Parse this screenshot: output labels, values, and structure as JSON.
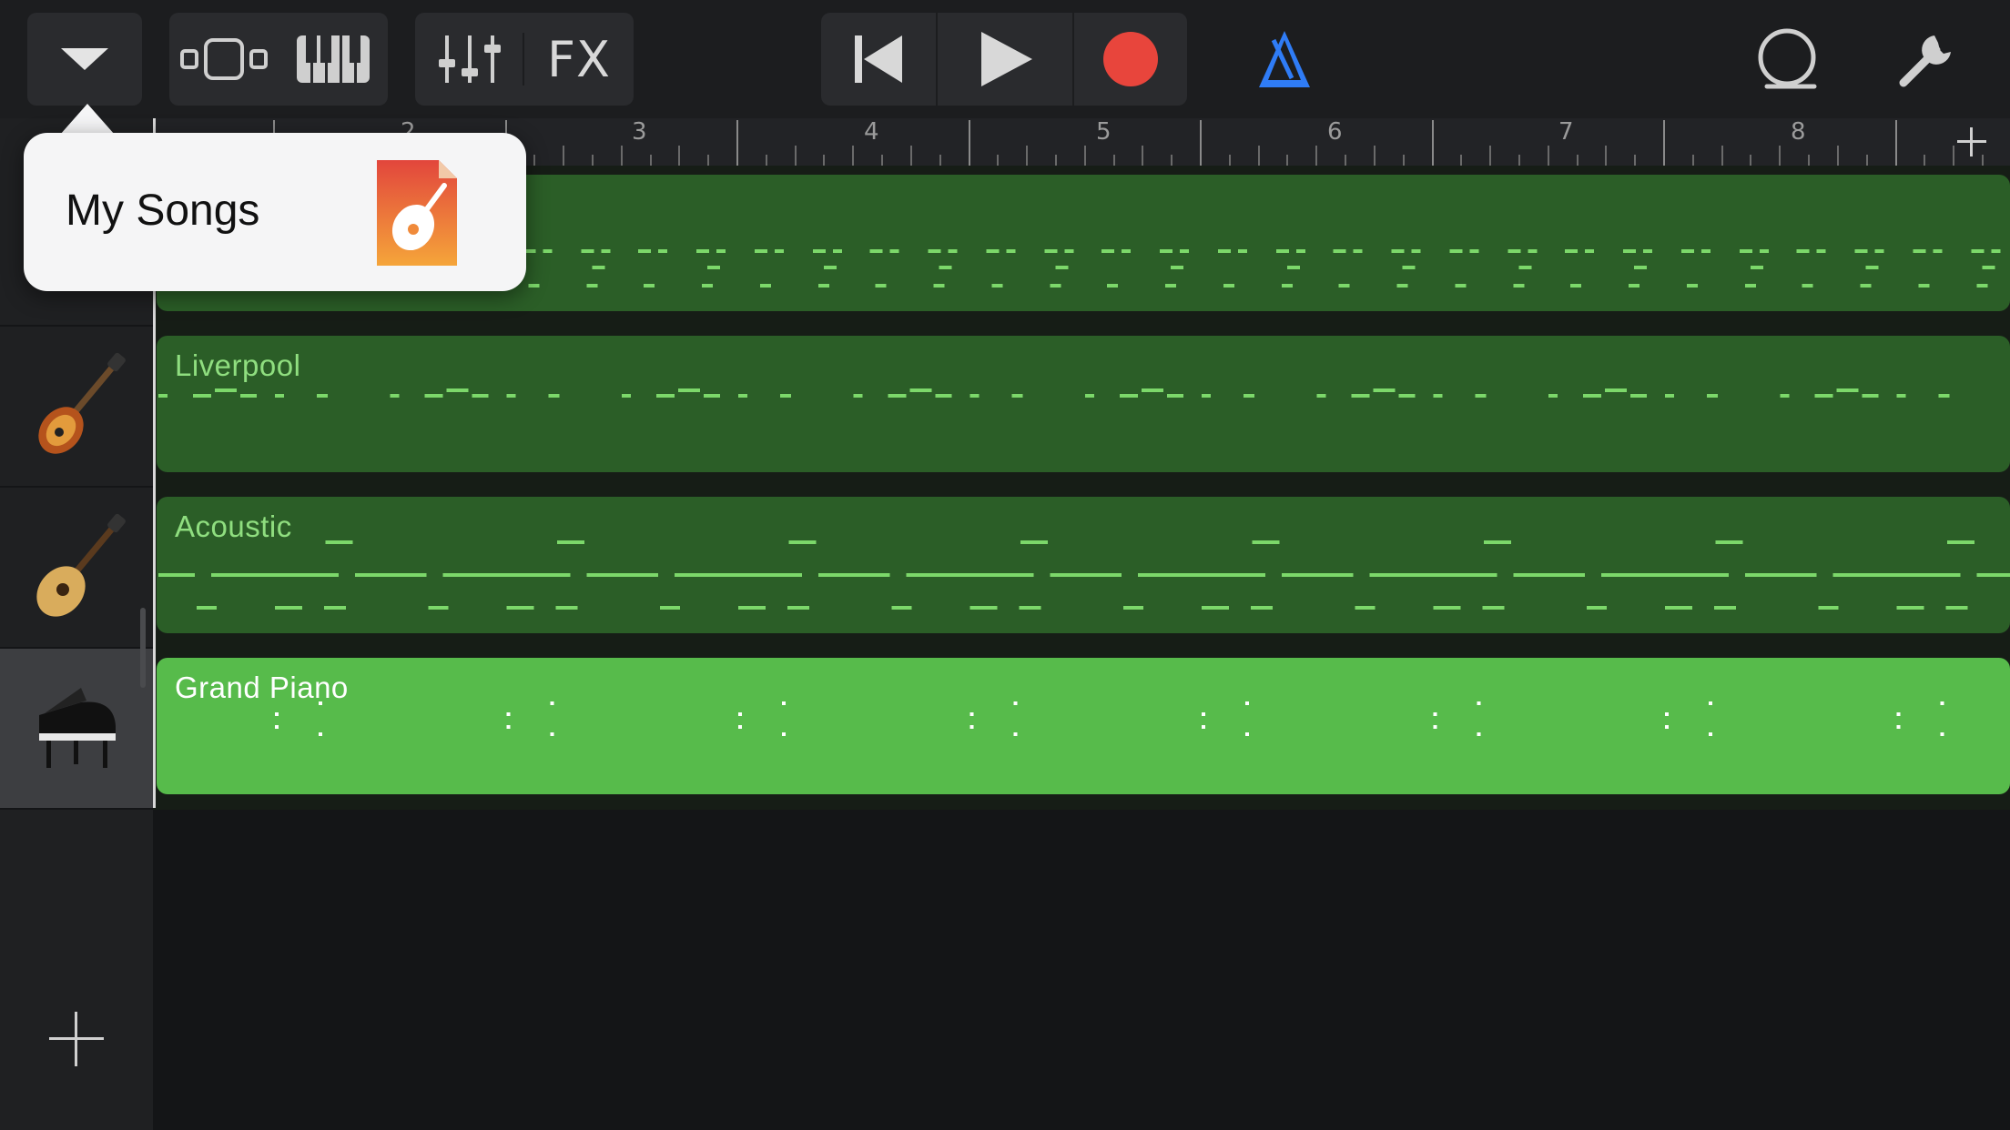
{
  "toolbar": {
    "fx_label": "FX",
    "icons": [
      "chevron-down-icon",
      "tracks-view-icon",
      "keyboard-icon",
      "mixer-icon",
      "rewind-icon",
      "play-icon",
      "record-icon",
      "metronome-icon",
      "loop-icon",
      "settings-wrench-icon"
    ],
    "colors": {
      "record": "#e8453c",
      "metronome": "#2f7cf6"
    }
  },
  "ruler": {
    "bar_numbers": [
      "2",
      "3",
      "4",
      "5",
      "6",
      "7",
      "8"
    ]
  },
  "popover": {
    "label": "My Songs",
    "icon": "garageband-song-icon"
  },
  "tracks": [
    {
      "name": "",
      "instrument_icon": "drum-icon",
      "selected": false,
      "style": "dark"
    },
    {
      "name": "Liverpool",
      "instrument_icon": "bass-guitar-icon",
      "selected": false,
      "style": "dark"
    },
    {
      "name": "Acoustic",
      "instrument_icon": "acoustic-guitar-icon",
      "selected": false,
      "style": "dark"
    },
    {
      "name": "Grand Piano",
      "instrument_icon": "grand-piano-icon",
      "selected": true,
      "style": "bright"
    }
  ],
  "colors": {
    "region_dark": "#2b5e27",
    "region_bright": "#57bb4b",
    "note_dark": "#7cd86a",
    "note_bright": "#ffffff"
  }
}
